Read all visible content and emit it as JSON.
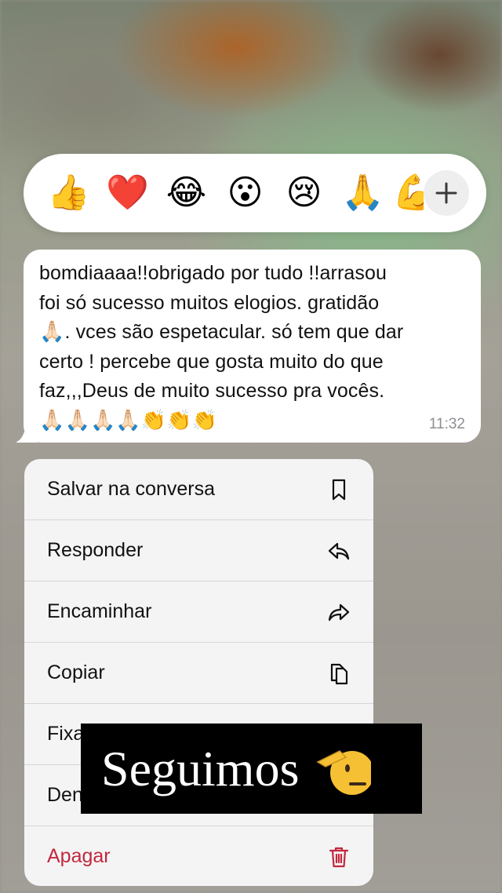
{
  "reactions": {
    "items": [
      {
        "name": "thumbs-up-icon",
        "glyph": "👍"
      },
      {
        "name": "red-heart-icon",
        "glyph": "❤️"
      },
      {
        "name": "tears-of-joy-icon",
        "glyph": "😂"
      },
      {
        "name": "surprised-face-icon",
        "glyph": "😮"
      },
      {
        "name": "crying-face-icon",
        "glyph": "😢"
      },
      {
        "name": "folded-hands-icon",
        "glyph": "🙏"
      },
      {
        "name": "flexed-biceps-icon",
        "glyph": "💪"
      }
    ],
    "more_icon": "plus-icon"
  },
  "message": {
    "lines": [
      "bomdiaaaa!!obrigado por tudo !!arrasou",
      "foi só sucesso muitos elogios. gratidão",
      ".  vces são espetacular. só tem que dar",
      "certo  ! percebe que gosta muito do que",
      "faz,,,Deus de muito sucesso pra vocês."
    ],
    "emoji_line2_prefix": "🙏🏻",
    "emoji_line6": "🙏🏻🙏🏻🙏🏻🙏🏻👏👏👏",
    "time": "11:32"
  },
  "menu": {
    "items": [
      {
        "label": "Salvar na conversa",
        "icon": "bookmark-icon"
      },
      {
        "label": "Responder",
        "icon": "reply-icon"
      },
      {
        "label": "Encaminhar",
        "icon": "forward-icon"
      },
      {
        "label": "Copiar",
        "icon": "copy-icon"
      },
      {
        "label": "Fixar",
        "icon": "pin-icon"
      },
      {
        "label": "Denunciar",
        "icon": "report-icon"
      },
      {
        "label": "Apagar",
        "icon": "trash-icon"
      }
    ],
    "danger_color": "#c2283f"
  },
  "caption": {
    "text": "Seguimos",
    "emoji": "saluting-face-icon"
  },
  "colors": {
    "bubble": "#ffffff",
    "menu_background": "#f4f4f4",
    "caption_background": "#000000"
  }
}
